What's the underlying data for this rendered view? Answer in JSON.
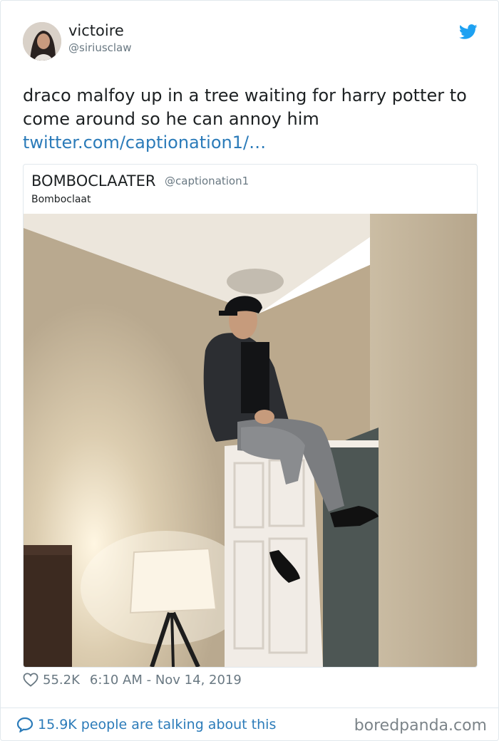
{
  "author": {
    "display_name": "victoire",
    "handle": "@siriusclaw"
  },
  "tweet": {
    "text_lines": [
      "draco malfoy up in a tree waiting for harry potter to",
      "come around so he can annoy him"
    ],
    "link": "twitter.com/caption​ation1/…"
  },
  "quoted_tweet": {
    "display_name": "BOMBOCLAATER",
    "handle": "@captionation1",
    "text": "Bomboclaat"
  },
  "meta": {
    "likes": "55.2K",
    "timestamp": "6:10 AM - Nov 14, 2019"
  },
  "footer": {
    "talking": "15.9K people are talking about this"
  },
  "watermark": "boredpanda.com",
  "icons": [
    "twitter-bird-icon",
    "heart-icon",
    "speech-bubble-icon"
  ],
  "colors": {
    "link": "#2b7bb9",
    "muted": "#697882",
    "twitter_blue": "#1da1f2"
  }
}
